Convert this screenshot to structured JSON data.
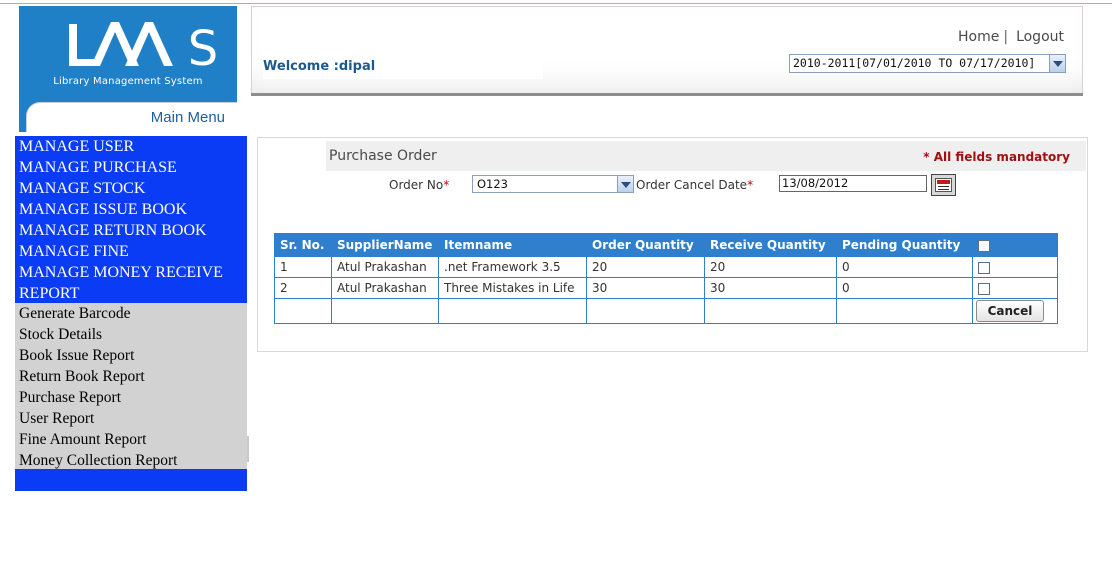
{
  "logo": {
    "text": "LAAS",
    "tagline": "Library Management System"
  },
  "main_menu_label": "Main Menu",
  "header": {
    "nav": [
      {
        "label": "Home"
      },
      {
        "label": "Logout"
      }
    ],
    "separator": "|",
    "welcome": "Welcome :dipal",
    "session": "2010-2011[07/01/2010 TO 07/17/2010]"
  },
  "sidebar": {
    "manage_items": [
      "MANAGE USER",
      "MANAGE PURCHASE",
      "MANAGE STOCK",
      "MANAGE ISSUE BOOK",
      "MANAGE RETURN BOOK",
      "MANAGE FINE",
      "MANAGE MONEY RECEIVE",
      "REPORT"
    ],
    "report_items": [
      "Generate Barcode",
      "Stock Details",
      "Book Issue Report",
      "Return Book Report",
      "Purchase Report",
      "User Report",
      "Fine Amount Report",
      "Money Collection Report"
    ]
  },
  "form": {
    "title": "Purchase Order",
    "mandatory_note": "* All fields mandatory",
    "order_no_label": "Order No",
    "order_no_value": "O123",
    "cancel_date_label": "Order Cancel Date",
    "cancel_date_value": "13/08/2012",
    "required_mark": "*"
  },
  "table": {
    "headers": [
      "Sr. No.",
      "SupplierName",
      "Itemname",
      "Order Quantity",
      "Receive Quantity",
      "Pending Quantity"
    ],
    "rows": [
      [
        "1",
        "Atul Prakashan",
        ".net Framework 3.5",
        "20",
        "20",
        "0"
      ],
      [
        "2",
        "Atul Prakashan",
        "Three Mistakes in Life",
        "30",
        "30",
        "0"
      ]
    ],
    "cancel_label": "Cancel"
  },
  "colors": {
    "logo_blue": "#1f7fc7",
    "sidebar_blue": "#0a3cf5",
    "table_header": "#2f7fcd",
    "mandatory_red": "#a01010"
  }
}
